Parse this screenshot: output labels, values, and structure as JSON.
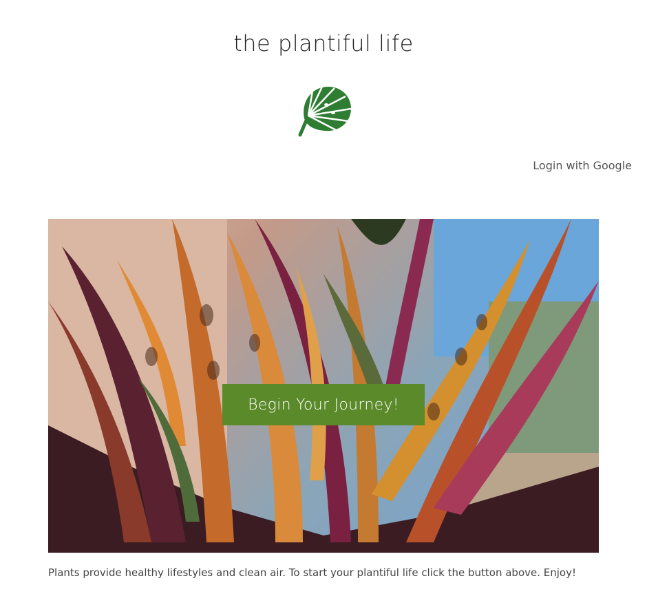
{
  "header": {
    "title": "the plantiful life",
    "logo_icon": "monstera-leaf-icon",
    "logo_color": "#2e7d32"
  },
  "auth": {
    "login_label": "Login with Google"
  },
  "hero": {
    "image_icon": "calathea-plant-photo",
    "cta_label": "Begin Your Journey!",
    "cta_color": "#5b8a2a"
  },
  "footer": {
    "tagline": "Plants provide healthy lifestyles and clean air. To start your plantiful life click the button above. Enjoy!"
  }
}
